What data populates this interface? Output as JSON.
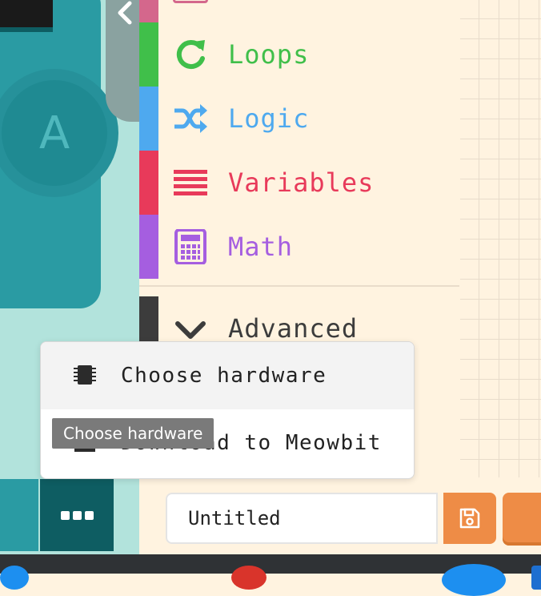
{
  "toolbox": {
    "categories": [
      {
        "label": "Loops",
        "color": "#40bf4a",
        "icon": "refresh-icon"
      },
      {
        "label": "Logic",
        "color": "#4ea9ef",
        "icon": "shuffle-icon"
      },
      {
        "label": "Variables",
        "color": "#e83a5a",
        "icon": "list-icon"
      },
      {
        "label": "Math",
        "color": "#a55ee0",
        "icon": "calculator-icon"
      }
    ],
    "advanced": {
      "label": "Advanced",
      "color": "#3c3c3c",
      "icon": "chevron-down-icon"
    }
  },
  "simulator": {
    "button_a_label": "A"
  },
  "menu": {
    "items": [
      {
        "label": "Choose hardware",
        "icon": "chip-icon"
      },
      {
        "label": "Download to Meowbit",
        "icon": "download-icon"
      }
    ]
  },
  "tooltip": {
    "text": "Choose hardware"
  },
  "project": {
    "name": "Untitled"
  },
  "colors": {
    "save_button": "#ee8c46",
    "simulator_bg": "#2a9ba3",
    "toolbox_bg": "#fff3e0"
  }
}
